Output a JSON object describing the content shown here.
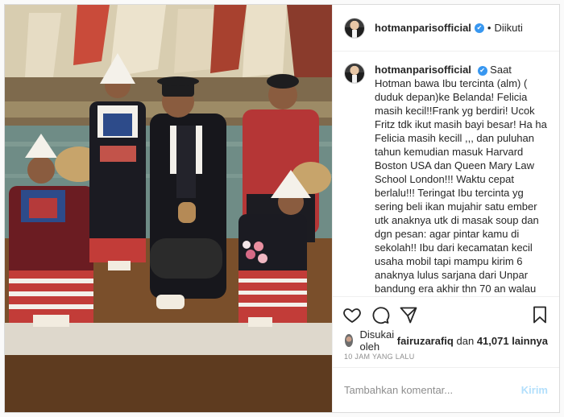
{
  "header": {
    "username": "hotmanparisofficial",
    "verified_mark": "✔",
    "separator": "•",
    "follow_status": "Diikuti"
  },
  "caption": {
    "username": "hotmanparisofficial",
    "verified_mark": "✔",
    "text": "Saat Hotman bawa Ibu tercinta (alm) ( duduk depan)ke Belanda! Felicia masih kecil!!Frank yg berdiri! Ucok Fritz tdk ikut masih bayi besar! Ha ha Felicia masih kecill ,,, dan puluhan tahun kemudian masuk Harvard Boston USA dan Queen Mary Law School London!!! Waktu cepat berlalu!!! Teringat Ibu tercinta yg sering beli ikan mujahir satu ember utk anaknya utk di masak soup dan dgn pesan: agar pintar kamu di sekolah!! Ibu dari kecamatan kecil usaha mobil tapi mampu kirim 6 anaknya lulus sarjana dari Unpar bandung era akhir thn 70 an walau Unpar sekolah mahal saat itu!! Berdiri Notaris Agustianne Marbun alias Ny"
  },
  "likes": {
    "prefix": "Disukai oleh",
    "liker": "fairuzarafiq",
    "connector": "dan",
    "count": "41,071",
    "suffix": "lainnya"
  },
  "timestamp": "10 JAM YANG LALU",
  "comment": {
    "placeholder": "Tambahkan komentar...",
    "post_label": "Kirim"
  },
  "icons": {
    "like": "heart-icon",
    "comment": "comment-icon",
    "share": "paper-plane-icon",
    "save": "bookmark-icon"
  },
  "colors": {
    "verified": "#3897f0",
    "post_button": "#b2dffc",
    "meta_text": "#8e8e8e"
  }
}
